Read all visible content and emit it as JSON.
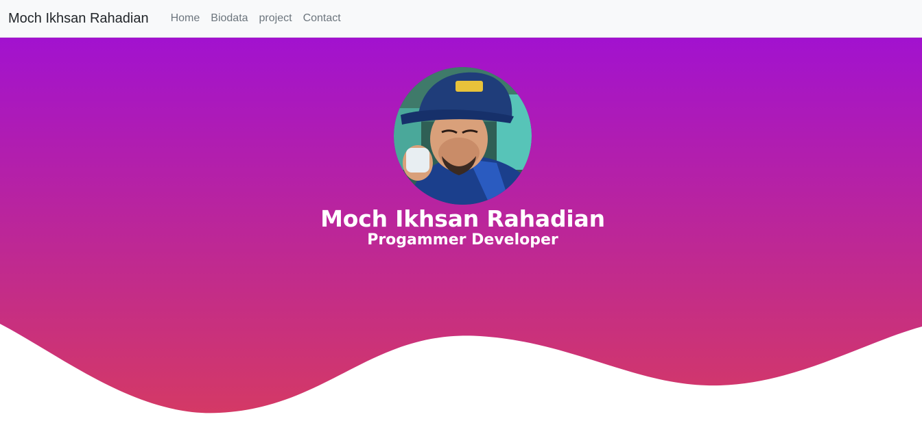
{
  "navbar": {
    "brand": "Moch Ikhsan Rahadian",
    "links": [
      {
        "label": "Home"
      },
      {
        "label": "Biodata"
      },
      {
        "label": "project"
      },
      {
        "label": "Contact"
      }
    ]
  },
  "hero": {
    "name": "Moch Ikhsan Rahadian",
    "role": "Progammer Developer",
    "avatar_icon": "profile-photo",
    "colors": {
      "gradient_top": "#a212cf",
      "gradient_bottom": "#d53a63",
      "wave": "#ffffff"
    }
  }
}
